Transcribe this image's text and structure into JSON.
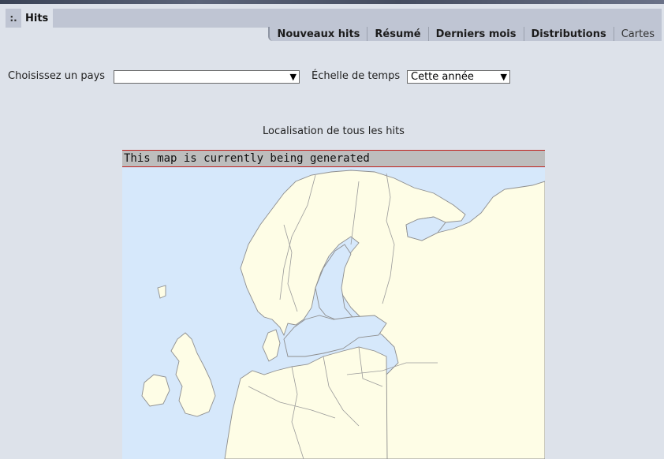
{
  "nav": {
    "prefix": ":.",
    "title": "Hits",
    "subtabs": [
      "Nouveaux hits",
      "Résumé",
      "Derniers mois",
      "Distributions",
      "Cartes"
    ]
  },
  "filters": {
    "country_label": "Choisissez un pays",
    "country_value": "",
    "time_label": "Échelle de temps",
    "time_value": "Cette année"
  },
  "map": {
    "title": "Localisation de tous les hits",
    "banner": "This map is currently being generated"
  },
  "colors": {
    "background": "#dde2ea",
    "tab_bar": "#bfc5d3",
    "sea": "#d6e8fb",
    "land": "#fefde6",
    "banner_border": "#c0201d"
  }
}
